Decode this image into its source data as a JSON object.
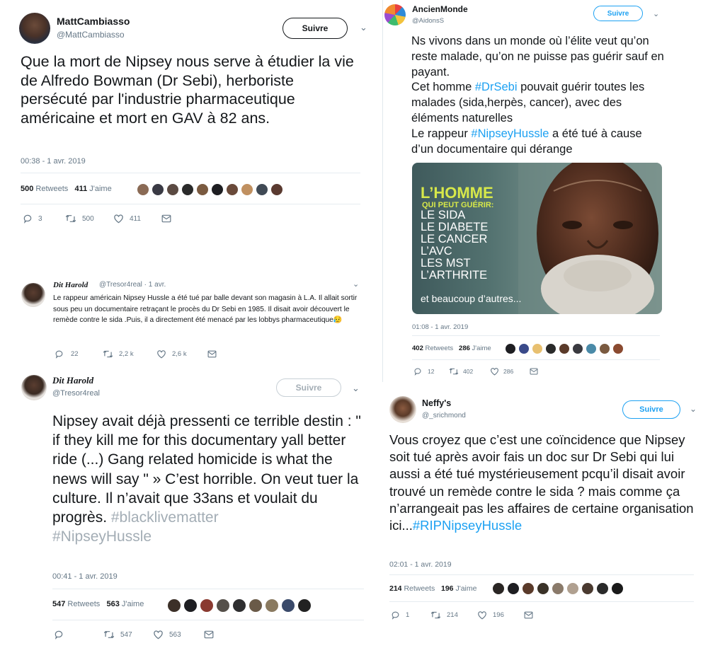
{
  "colors": {
    "link": "#1da1f2",
    "grey_tag": "#a3adb5",
    "muted": "#657786",
    "follow_blue": "#1da1f2"
  },
  "t1": {
    "name": "MattCambiasso",
    "handle": "@MattCambiasso",
    "follow": "Suivre",
    "text": "Que la mort de Nipsey nous serve à étudier la vie de Alfredo Bowman (Dr Sebi), herboriste persécuté par l'industrie pharmaceutique américaine et mort en GAV à 82 ans.",
    "time": "00:38 - 1 avr. 2019",
    "retweets_count": "500",
    "retweets_label": "Retweets",
    "likes_count": "411",
    "likes_label": "J'aime",
    "reply": "3",
    "rt": "500",
    "like": "411"
  },
  "t2": {
    "name": "Dit Harold",
    "handle": "@Tresor4real · 1 avr.",
    "text": "Le rappeur américain Nipsey Hussle a été tué par balle devant son magasin à L.A. Il allait sortir sous peu un documentaire retraçant le procès du Dr Sebi en 1985. Il disait avoir découvert le remède contre le sida .Puis, il a directement été menacé par les lobbys pharmaceutique😥",
    "reply": "22",
    "rt": "2,2 k",
    "like": "2,6 k"
  },
  "t3": {
    "name": "Dit Harold",
    "handle": "@Tresor4real",
    "follow": "Suivre",
    "text_main": "Nipsey avait déjà pressenti ce terrible destin : \" if they kill me for this documentary yall better ride (...) Gang related homicide is what the news will say \" » C’est horrible. On veut tuer la culture. Il n’avait que 33ans et voulait du progrès. ",
    "tag1": "#blacklivematter",
    "tag2": "#NipseyHussle",
    "time": "00:41 - 1 avr. 2019",
    "retweets_count": "547",
    "retweets_label": "Retweets",
    "likes_count": "563",
    "likes_label": "J'aime",
    "reply": "",
    "rt": "547",
    "like": "563"
  },
  "t4": {
    "name": "AncienMonde",
    "handle": "@AidonsS",
    "follow": "Suivre",
    "text1": "Ns vivons dans un monde où l’élite veut qu’on reste malade, qu’on ne puisse pas guérir sauf en payant.",
    "text2a": "Cet homme ",
    "tag1": "#DrSebi",
    "text2b": " pouvait guérir toutes les malades (sida,herpès, cancer), avec des éléments naturelles",
    "text3a": "Le rappeur ",
    "tag2": "#NipseyHussle",
    "text3b": " a été tué à cause d’un documentaire qui dérange",
    "img_title": "L’HOMME",
    "img_sub": "QUI PEUT GUÉRIR:",
    "img_list": [
      "LE SIDA",
      "LE DIABETE",
      "LE CANCER",
      "L’AVC",
      "LES MST",
      "L’ARTHRITE"
    ],
    "img_footer": "et beaucoup d’autres...",
    "time": "01:08 - 1 avr. 2019",
    "retweets_count": "402",
    "retweets_label": "Retweets",
    "likes_count": "286",
    "likes_label": "J'aime",
    "reply": "12",
    "rt": "402",
    "like": "286"
  },
  "t5": {
    "name": "Neffy's",
    "handle": "@_srichmond",
    "follow": "Suivre",
    "text": "Vous croyez que c’est une coïncidence que Nipsey soit tué après avoir fais un doc sur Dr Sebi qui lui aussi a été tué mystérieusement pcqu’il disait avoir trouvé un remède contre le sida ? mais comme ça n’arrangeait pas les affaires de certaine organisation ici...",
    "tag": "#RIPNipseyHussle",
    "time": "02:01 - 1 avr. 2019",
    "retweets_count": "214",
    "retweets_label": "Retweets",
    "likes_count": "196",
    "likes_label": "J'aime",
    "reply": "1",
    "rt": "214",
    "like": "196"
  }
}
